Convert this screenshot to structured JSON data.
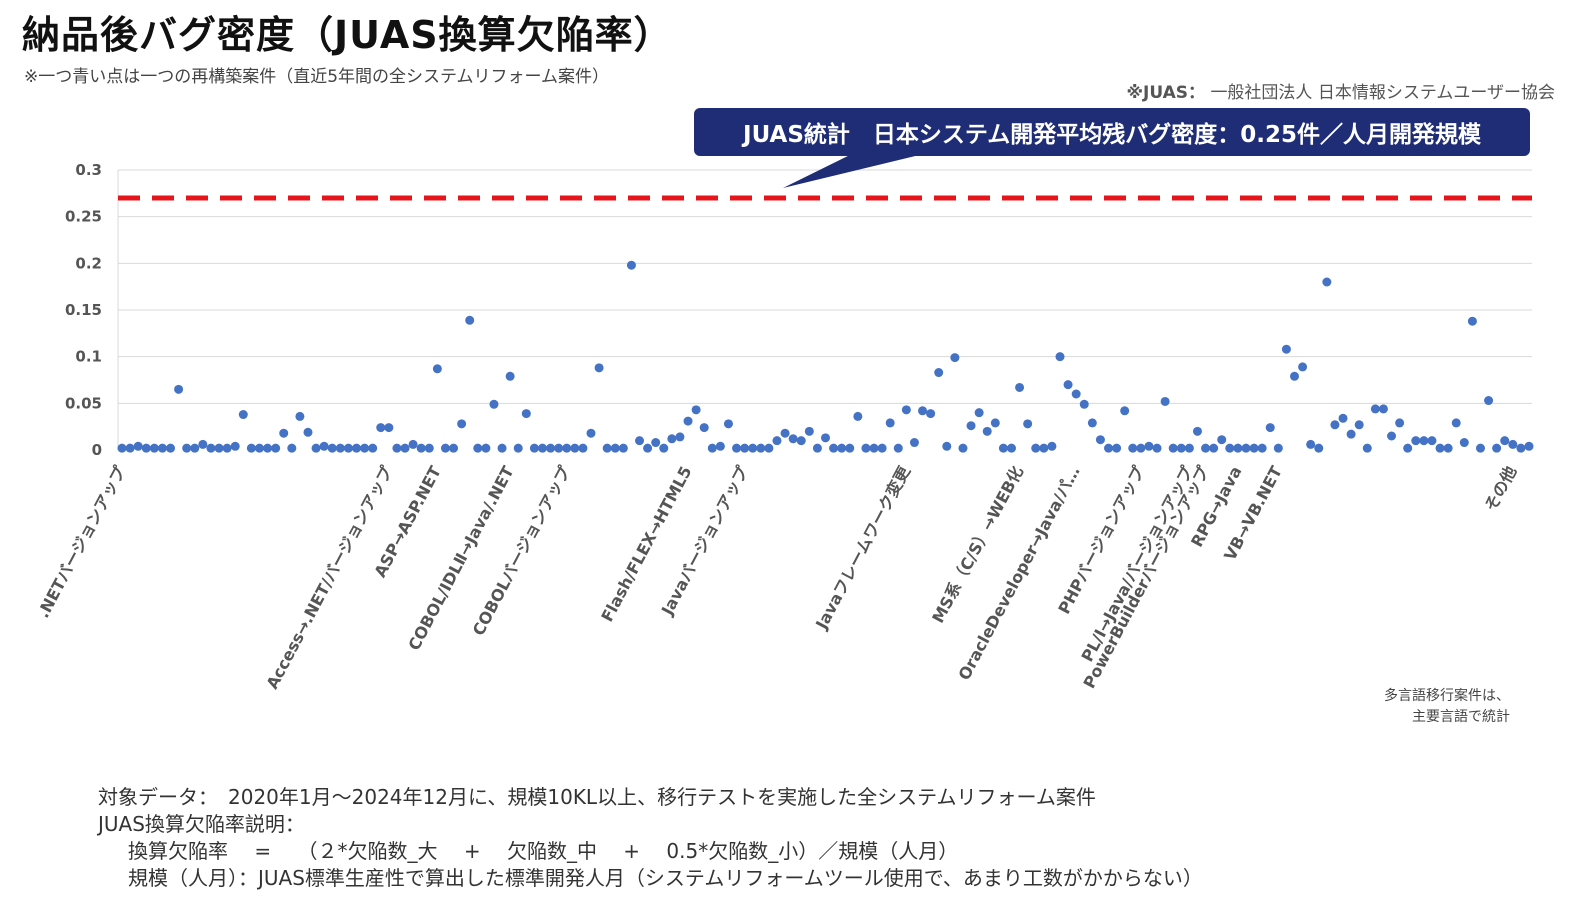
{
  "header": {
    "title": "納品後バグ密度（JUAS換算欠陥率）",
    "subtitle": "※一つ青い点は一つの再構築案件（直近5年間の全システムリフォーム案件）",
    "juas_prefix": "※JUAS：",
    "juas_name": "一般社団法人 日本情報システムユーザー協会"
  },
  "callout": {
    "text": "JUAS統計　日本システム開発平均残バグ密度：0.25件／人月開発規模"
  },
  "colors": {
    "point": "#4472c4",
    "reference_line": "#e8141c",
    "callout_bg": "#1f2d77",
    "grid": "#d9d9d9"
  },
  "chart_data": {
    "type": "scatter",
    "title": "納品後バグ密度（JUAS換算欠陥率）",
    "ylim": [
      0,
      0.3
    ],
    "y_ticks": [
      "0",
      "0.05",
      "0.1",
      "0.15",
      "0.2",
      "0.25",
      "0.3"
    ],
    "grid": true,
    "reference_line": {
      "value": 0.27,
      "label": "JUAS統計　日本システム開発平均残バグ密度：0.25件／人月開発規模"
    },
    "categories": [
      {
        "label": ".NETバージョンアップ",
        "index": 0
      },
      {
        "label": "Access→.NET/バージョンアップ",
        "index": 33
      },
      {
        "label": "ASP→ASP.NET",
        "index": 39
      },
      {
        "label": "COBOL/IDLⅡ→Java/.NET",
        "index": 48
      },
      {
        "label": "COBOLバージョンアップ",
        "index": 55
      },
      {
        "label": "Flash/FLEX→HTML5",
        "index": 70
      },
      {
        "label": "Javaバージョンアップ",
        "index": 77
      },
      {
        "label": "Javaフレームワーク変更",
        "index": 97
      },
      {
        "label": "MS系（C/S）→WEB化",
        "index": 111
      },
      {
        "label": "OracleDeveloper→Java/パ…",
        "index": 118
      },
      {
        "label": "PHPバージョンアップ",
        "index": 126
      },
      {
        "label": "PL/Ⅰ→Java/バージョンアップ",
        "index": 132
      },
      {
        "label": "PowerBuilderバージョンアップ",
        "index": 134
      },
      {
        "label": "RPG→Java",
        "index": 138
      },
      {
        "label": "VB→VB.NET",
        "index": 143
      },
      {
        "label": "その他",
        "index": 172
      }
    ],
    "values": [
      0.002,
      0.002,
      0.004,
      0.002,
      0.002,
      0.002,
      0.002,
      0.065,
      0.002,
      0.002,
      0.006,
      0.002,
      0.002,
      0.002,
      0.004,
      0.038,
      0.002,
      0.002,
      0.002,
      0.002,
      0.018,
      0.002,
      0.036,
      0.019,
      0.002,
      0.004,
      0.002,
      0.002,
      0.002,
      0.002,
      0.002,
      0.002,
      0.024,
      0.024,
      0.002,
      0.002,
      0.006,
      0.002,
      0.002,
      0.087,
      0.002,
      0.002,
      0.028,
      0.139,
      0.002,
      0.002,
      0.049,
      0.002,
      0.079,
      0.002,
      0.039,
      0.002,
      0.002,
      0.002,
      0.002,
      0.002,
      0.002,
      0.002,
      0.018,
      0.088,
      0.002,
      0.002,
      0.002,
      0.198,
      0.01,
      0.002,
      0.008,
      0.002,
      0.012,
      0.014,
      0.031,
      0.043,
      0.024,
      0.002,
      0.004,
      0.028,
      0.002,
      0.002,
      0.002,
      0.002,
      0.002,
      0.01,
      0.018,
      0.012,
      0.01,
      0.02,
      0.002,
      0.013,
      0.002,
      0.002,
      0.002,
      0.036,
      0.002,
      0.002,
      0.002,
      0.029,
      0.002,
      0.043,
      0.008,
      0.042,
      0.039,
      0.083,
      0.004,
      0.099,
      0.002,
      0.026,
      0.04,
      0.02,
      0.029,
      0.002,
      0.002,
      0.067,
      0.028,
      0.002,
      0.002,
      0.004,
      0.1,
      0.07,
      0.06,
      0.049,
      0.029,
      0.011,
      0.002,
      0.002,
      0.042,
      0.002,
      0.002,
      0.004,
      0.002,
      0.052,
      0.002,
      0.002,
      0.002,
      0.02,
      0.002,
      0.002,
      0.011,
      0.002,
      0.002,
      0.002,
      0.002,
      0.002,
      0.024,
      0.002,
      0.108,
      0.079,
      0.089,
      0.006,
      0.002,
      0.18,
      0.027,
      0.034,
      0.017,
      0.027,
      0.002,
      0.044,
      0.044,
      0.015,
      0.029,
      0.002,
      0.01,
      0.01,
      0.01,
      0.002,
      0.002,
      0.029,
      0.008,
      0.138,
      0.002,
      0.053,
      0.002,
      0.01,
      0.006,
      0.002,
      0.004
    ]
  },
  "side_note": {
    "line1": "多言語移行案件は、",
    "line2": "主要言語で統計"
  },
  "footer": {
    "line1": "対象データ：　2020年1月～2024年12月に、規模10KL以上、移行テストを実施した全システムリフォーム案件",
    "line2": "JUAS換算欠陥率説明：",
    "line3": "換算欠陥率　 =　 （２*欠陥数_大　 +　 欠陥数_中　 +　 0.5*欠陥数_小）／規模（人月）",
    "line4": "規模（人月）：JUAS標準生産性で算出した標準開発人月（システムリフォームツール使用で、あまり工数がかからない）"
  }
}
